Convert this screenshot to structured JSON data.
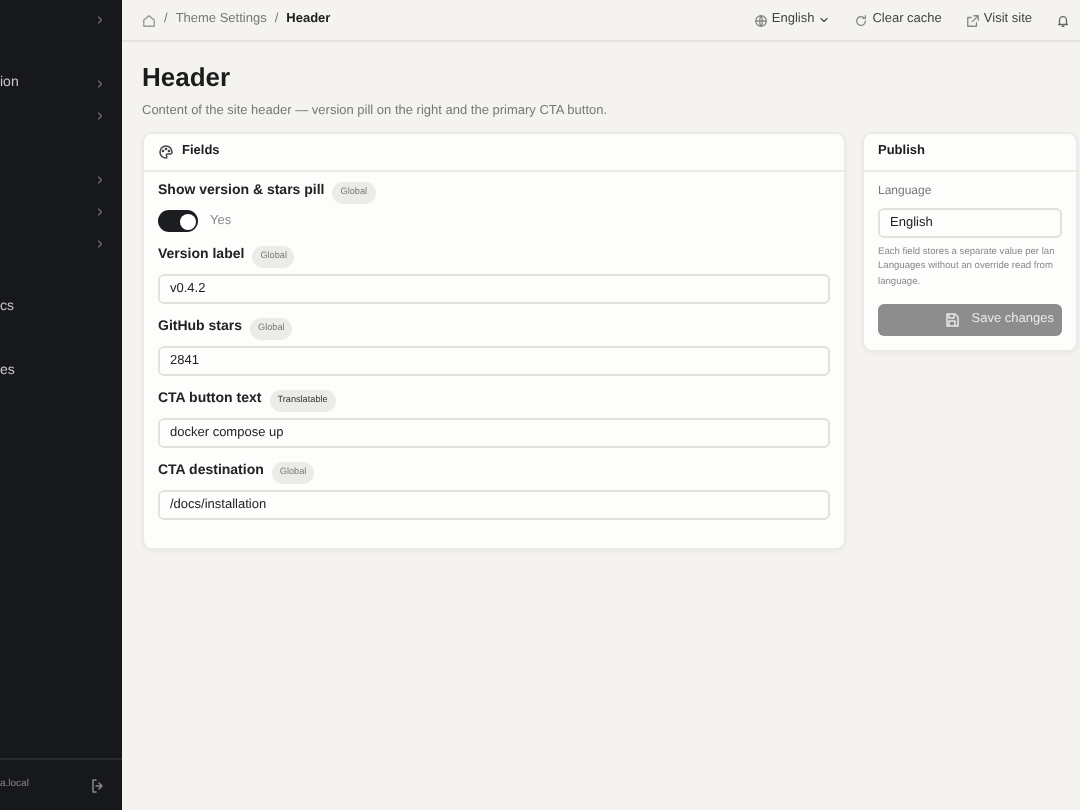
{
  "sidebar": {
    "sections": [
      [
        {
          "expandable": true
        }
      ],
      [
        {
          "label": "ion",
          "expandable": true
        },
        {
          "expandable": true
        }
      ],
      [
        {
          "expandable": true
        },
        {
          "expandable": true
        },
        {
          "expandable": true
        }
      ],
      [
        {
          "label": "cs",
          "expandable": false
        }
      ],
      [
        {
          "label": "es",
          "expandable": false
        }
      ]
    ],
    "footer": {
      "user": "a.local"
    }
  },
  "breadcrumb": [
    {
      "kind": "home"
    },
    {
      "sep": "/",
      "label": "Theme Settings",
      "current": false
    },
    {
      "sep": "/",
      "label": "Header",
      "current": true
    }
  ],
  "topbar": {
    "language": "English",
    "actions": [
      {
        "kind": "refresh",
        "label": "Clear cache"
      },
      {
        "kind": "external",
        "label": "Visit site"
      }
    ]
  },
  "page": {
    "title": "Header",
    "subtitle": "Content of the site header — version pill on the right and the primary CTA button."
  },
  "fields_card": {
    "title": "Fields",
    "fields": [
      {
        "kind": "toggle",
        "label": "Show version & stars pill",
        "badge": "Global",
        "on": true,
        "value_label": "Yes"
      },
      {
        "kind": "text",
        "label": "Version label",
        "badge": "Global",
        "value": "v0.4.2"
      },
      {
        "kind": "text",
        "label": "GitHub stars",
        "badge": "Global",
        "value": "2841"
      },
      {
        "kind": "text",
        "label": "CTA button text",
        "badge": "Translatable",
        "value": "docker compose up"
      },
      {
        "kind": "text",
        "label": "CTA destination",
        "badge": "Global",
        "value": "/docs/installation"
      }
    ]
  },
  "publish_card": {
    "title": "Publish",
    "language_label": "Language",
    "language": "English",
    "help_lines": [
      "Each field stores a separate value per lan",
      "Languages without an override read from",
      "language."
    ],
    "save_button": {
      "label": "Save changes",
      "disabled": true
    }
  }
}
